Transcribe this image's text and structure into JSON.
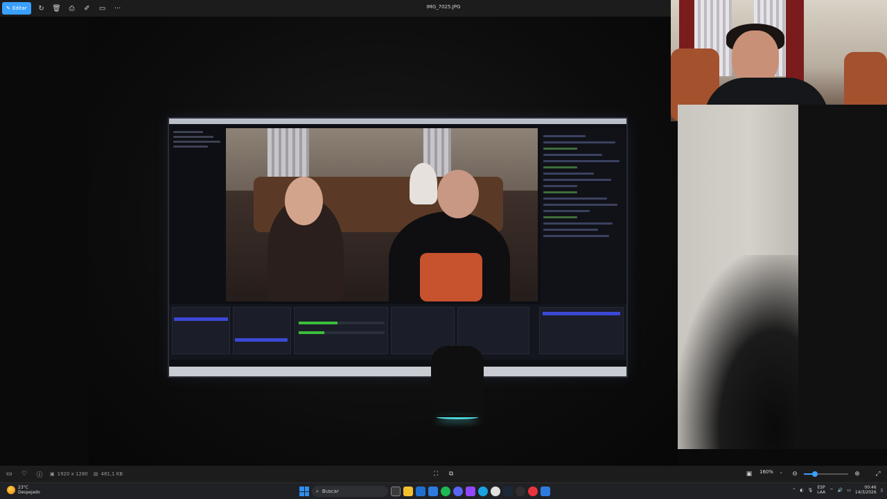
{
  "toolbar": {
    "edit_label": "Editar",
    "file_name": "IMG_7025.JPG",
    "icons": [
      "rotate-icon",
      "delete-icon",
      "print-icon",
      "edit-image-icon",
      "slideshow-icon",
      "more-icon"
    ]
  },
  "statusbar": {
    "dimensions": "1920 x 1280",
    "file_size": "481,1 KB",
    "zoom_level": "160%",
    "zoom_fraction": 0.25
  },
  "taskbar": {
    "temperature": "23°C",
    "weather": "Despejado",
    "search_placeholder": "Buscar",
    "language_top": "ESP",
    "language_bottom": "LAA",
    "time": "00:46",
    "date": "14/3/2026"
  },
  "colors": {
    "accent": "#3aa0ff",
    "toolbar_bg": "#1c1c1c",
    "taskbar_bg": "#202124"
  }
}
